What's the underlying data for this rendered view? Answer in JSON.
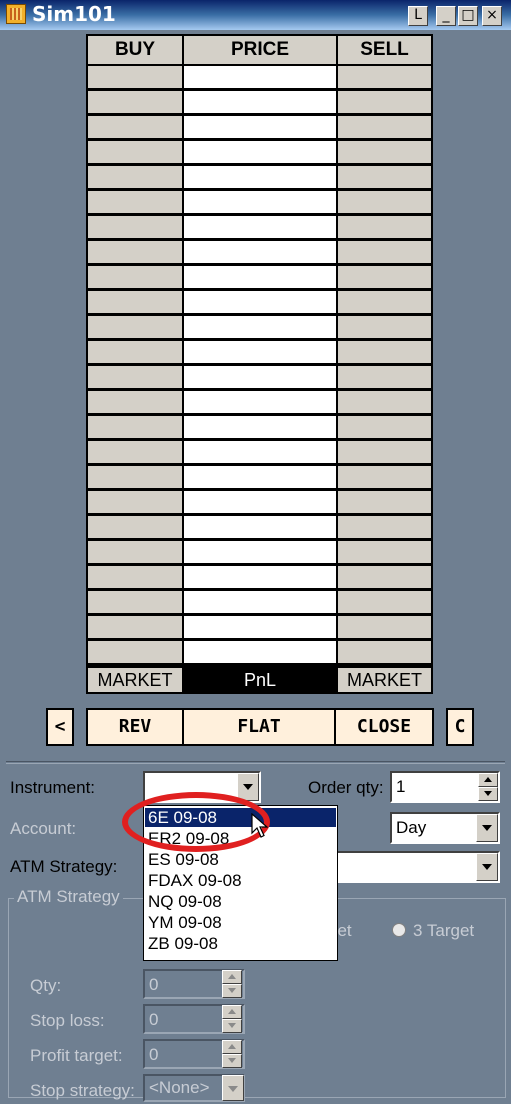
{
  "window": {
    "title": "Sim101",
    "buttons": [
      "L",
      "_",
      "□",
      "×"
    ]
  },
  "ladder": {
    "headers": {
      "buy": "BUY",
      "price": "PRICE",
      "sell": "SELL"
    },
    "row_count": 24,
    "footer": {
      "buy": "MARKET",
      "price": "PnL",
      "sell": "MARKET"
    }
  },
  "actions": {
    "left_arrow": "<",
    "rev": "REV",
    "flat": "FLAT",
    "close": "CLOSE",
    "c": "C"
  },
  "form": {
    "instrument_label": "Instrument:",
    "instrument_value": "",
    "order_qty_label": "Order qty:",
    "order_qty_value": "1",
    "account_label": "Account:",
    "tif_value": "Day",
    "atm_strategy_label": "ATM Strategy:",
    "atm_group_label": "ATM Strategy",
    "target_partial": "get",
    "target3_label": "3 Target",
    "qty_label": "Qty:",
    "qty_value": "0",
    "stop_loss_label": "Stop loss:",
    "stop_loss_value": "0",
    "profit_target_label": "Profit target:",
    "profit_target_value": "0",
    "stop_strategy_label": "Stop strategy:",
    "stop_strategy_value": "<None>"
  },
  "dropdown": {
    "items": [
      "6E 09-08",
      "ER2 09-08",
      "ES 09-08",
      "FDAX 09-08",
      "NQ 09-08",
      "YM 09-08",
      "ZB 09-08"
    ],
    "selected_index": 0
  },
  "colors": {
    "accent_highlight": "#e02020",
    "selection": "#0a246a",
    "button_fill": "#fff0dc"
  }
}
